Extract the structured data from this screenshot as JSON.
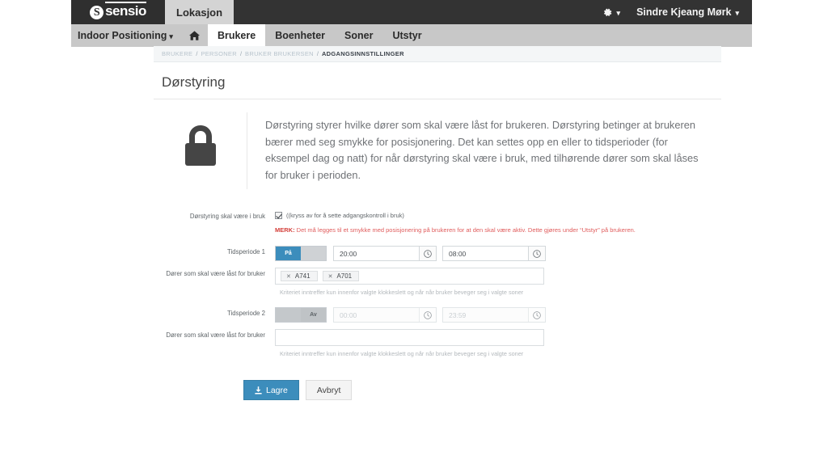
{
  "topbar": {
    "logo_text": "sensio",
    "location_tab": "Lokasjon",
    "gear_icon": "gear-icon",
    "gear_caret": "▾",
    "user_name": "Sindre Kjeang Mørk",
    "user_caret": "▾"
  },
  "nav": {
    "brand": "Indoor Positioning",
    "brand_caret": "▾",
    "home_icon": "home-icon",
    "items": [
      {
        "label": "Brukere",
        "active": true
      },
      {
        "label": "Boenheter",
        "active": false
      },
      {
        "label": "Soner",
        "active": false
      },
      {
        "label": "Utstyr",
        "active": false
      }
    ]
  },
  "breadcrumb": {
    "separator": "/",
    "items": [
      {
        "label": "BRUKERE",
        "active": false
      },
      {
        "label": "PERSONER",
        "active": false
      },
      {
        "label": "BRUKER BRUKERSEN",
        "active": false
      },
      {
        "label": "ADGANGSINNSTILLINGER",
        "active": true
      }
    ]
  },
  "page": {
    "title": "Dørstyring",
    "lock_icon": "padlock-icon",
    "description": "Dørstyring styrer hvilke dører som skal være låst for brukeren. Dørstyring betinger at brukeren bærer med seg smykke for posisjonering. Det kan settes opp en eller to tidsperioder (for eksempel dag og natt) for når dørstyring skal være i bruk, med tilhørende dører som skal låses for bruker i perioden."
  },
  "form": {
    "enable": {
      "label": "Dørstyring skal være i bruk",
      "checkbox_label": "((kryss av for å sette adgangskontroll i bruk)",
      "checked": true,
      "warning_prefix": "MERK:",
      "warning_text": " Det må legges til et smykke med posisjonering på brukeren for at den skal være aktiv. Dette gjøres under “Utstyr” på brukeren."
    },
    "period1": {
      "label": "Tidsperiode 1",
      "toggle_on_label": "På",
      "toggle_off_label": "",
      "state": "on",
      "start_time": "20:00",
      "end_time": "08:00",
      "clock_icon": "clock-icon",
      "doors_label": "Dører som skal være låst for bruker",
      "doors": [
        "A741",
        "A701"
      ],
      "tag_remove_icon": "✕",
      "hint": "Kriteriet inntreffer kun innenfor valgte klokkeslett og når når bruker beveger seg i valgte soner"
    },
    "period2": {
      "label": "Tidsperiode 2",
      "toggle_on_label": "",
      "toggle_off_label": "Av",
      "state": "off",
      "start_time": "00:00",
      "end_time": "23:59",
      "clock_icon": "clock-icon",
      "doors_label": "Dører som skal være låst for bruker",
      "doors": [],
      "hint": "Kriteriet inntreffer kun innenfor valgte klokkeslett og når når bruker beveger seg i valgte soner"
    },
    "buttons": {
      "save_label": "Lagre",
      "save_icon": "download-icon",
      "cancel_label": "Avbryt"
    }
  },
  "colors": {
    "accent_blue": "#3c8dbc",
    "topbar_dark": "#333333",
    "nav_grey": "#c8c8c8",
    "warning_red": "#e05c5c"
  }
}
